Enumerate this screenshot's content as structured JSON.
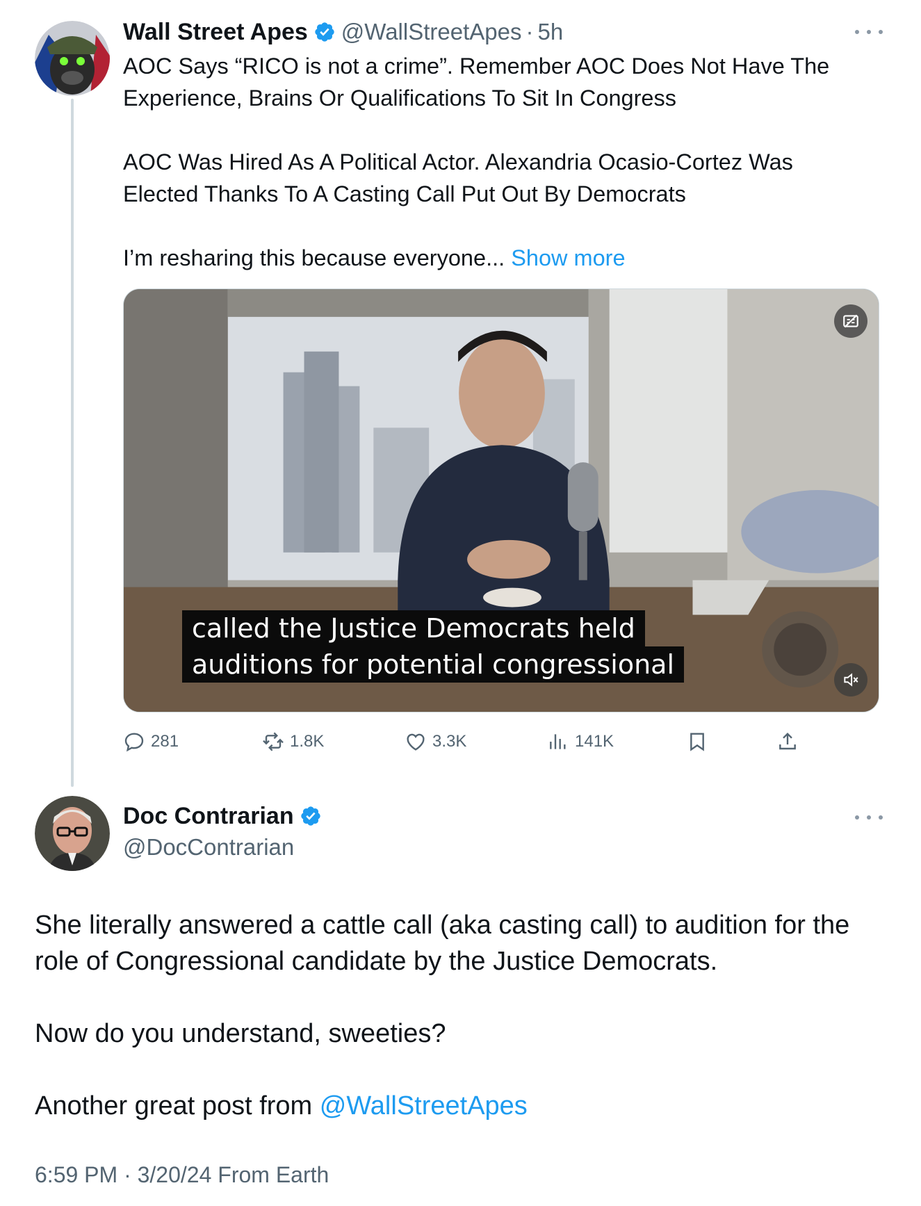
{
  "original_tweet": {
    "author_name": "Wall Street Apes",
    "handle": "@WallStreetApes",
    "separator": "·",
    "time_ago": "5h",
    "text_lines": [
      "AOC Says “RICO is not a crime”. Remember AOC Does Not Have The",
      "Experience, Brains Or Qualifications To Sit In Congress",
      "AOC Was Hired As A Political Actor. Alexandria Ocasio-Cortez Was",
      "Elected Thanks To A Casting Call Put Out By Democrats",
      "I’m resharing this because everyone... "
    ],
    "show_more": "Show more",
    "video": {
      "caption_line1": "called the Justice Democrats held",
      "caption_line2": "auditions for potential congressional"
    },
    "stats": {
      "replies": "281",
      "reposts": "1.8K",
      "likes": "3.3K",
      "views": "141K"
    }
  },
  "reply_tweet": {
    "author_name": "Doc Contrarian",
    "handle": "@DocContrarian",
    "text_line1": "She literally answered a cattle call (aka casting call) to audition for the role of Congressional candidate by the Justice Democrats.",
    "text_line2": "Now do you understand, sweeties?",
    "text_line3_prefix": "Another great post from ",
    "mention": "@WallStreetApes",
    "timestamp": "6:59 PM · 3/20/24 From Earth"
  },
  "colors": {
    "accent": "#1d9bf0",
    "secondary_text": "#536471",
    "primary_text": "#0f1419",
    "thread_line": "#cfd9de"
  },
  "icons": [
    "verified-badge-icon",
    "more-icon",
    "captions-icon",
    "mute-icon",
    "reply-icon",
    "repost-icon",
    "like-icon",
    "views-icon",
    "bookmark-icon",
    "share-icon"
  ]
}
